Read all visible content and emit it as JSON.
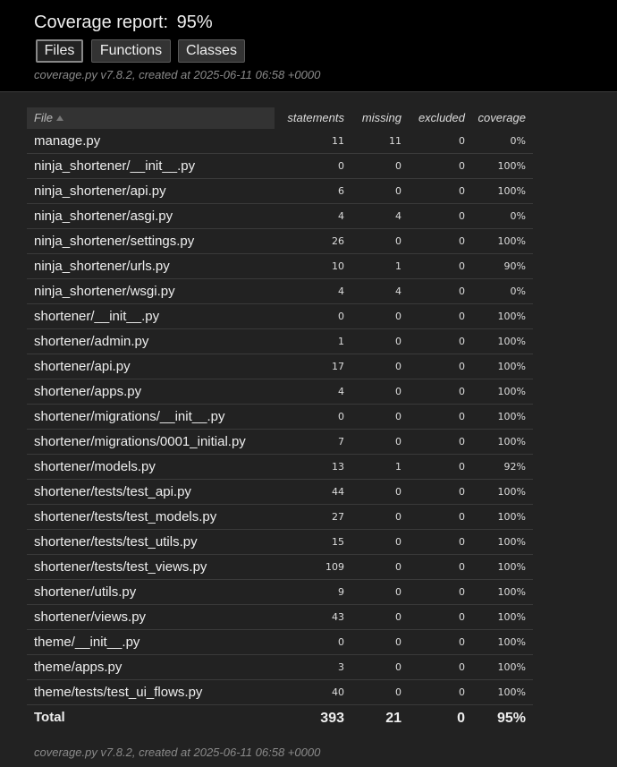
{
  "header": {
    "title": "Coverage report:",
    "percent": "95%",
    "tabs": [
      {
        "label": "Files"
      },
      {
        "label": "Functions"
      },
      {
        "label": "Classes"
      }
    ],
    "meta": "coverage.py v7.8.2, created at 2025-06-11 06:58 +0000"
  },
  "table": {
    "columns": [
      "File",
      "statements",
      "missing",
      "excluded",
      "coverage"
    ],
    "rows": [
      {
        "file": "manage.py",
        "statements": "11",
        "missing": "11",
        "excluded": "0",
        "coverage": "0%"
      },
      {
        "file": "ninja_shortener/__init__.py",
        "statements": "0",
        "missing": "0",
        "excluded": "0",
        "coverage": "100%"
      },
      {
        "file": "ninja_shortener/api.py",
        "statements": "6",
        "missing": "0",
        "excluded": "0",
        "coverage": "100%"
      },
      {
        "file": "ninja_shortener/asgi.py",
        "statements": "4",
        "missing": "4",
        "excluded": "0",
        "coverage": "0%"
      },
      {
        "file": "ninja_shortener/settings.py",
        "statements": "26",
        "missing": "0",
        "excluded": "0",
        "coverage": "100%"
      },
      {
        "file": "ninja_shortener/urls.py",
        "statements": "10",
        "missing": "1",
        "excluded": "0",
        "coverage": "90%"
      },
      {
        "file": "ninja_shortener/wsgi.py",
        "statements": "4",
        "missing": "4",
        "excluded": "0",
        "coverage": "0%"
      },
      {
        "file": "shortener/__init__.py",
        "statements": "0",
        "missing": "0",
        "excluded": "0",
        "coverage": "100%"
      },
      {
        "file": "shortener/admin.py",
        "statements": "1",
        "missing": "0",
        "excluded": "0",
        "coverage": "100%"
      },
      {
        "file": "shortener/api.py",
        "statements": "17",
        "missing": "0",
        "excluded": "0",
        "coverage": "100%"
      },
      {
        "file": "shortener/apps.py",
        "statements": "4",
        "missing": "0",
        "excluded": "0",
        "coverage": "100%"
      },
      {
        "file": "shortener/migrations/__init__.py",
        "statements": "0",
        "missing": "0",
        "excluded": "0",
        "coverage": "100%"
      },
      {
        "file": "shortener/migrations/0001_initial.py",
        "statements": "7",
        "missing": "0",
        "excluded": "0",
        "coverage": "100%"
      },
      {
        "file": "shortener/models.py",
        "statements": "13",
        "missing": "1",
        "excluded": "0",
        "coverage": "92%"
      },
      {
        "file": "shortener/tests/test_api.py",
        "statements": "44",
        "missing": "0",
        "excluded": "0",
        "coverage": "100%"
      },
      {
        "file": "shortener/tests/test_models.py",
        "statements": "27",
        "missing": "0",
        "excluded": "0",
        "coverage": "100%"
      },
      {
        "file": "shortener/tests/test_utils.py",
        "statements": "15",
        "missing": "0",
        "excluded": "0",
        "coverage": "100%"
      },
      {
        "file": "shortener/tests/test_views.py",
        "statements": "109",
        "missing": "0",
        "excluded": "0",
        "coverage": "100%"
      },
      {
        "file": "shortener/utils.py",
        "statements": "9",
        "missing": "0",
        "excluded": "0",
        "coverage": "100%"
      },
      {
        "file": "shortener/views.py",
        "statements": "43",
        "missing": "0",
        "excluded": "0",
        "coverage": "100%"
      },
      {
        "file": "theme/__init__.py",
        "statements": "0",
        "missing": "0",
        "excluded": "0",
        "coverage": "100%"
      },
      {
        "file": "theme/apps.py",
        "statements": "3",
        "missing": "0",
        "excluded": "0",
        "coverage": "100%"
      },
      {
        "file": "theme/tests/test_ui_flows.py",
        "statements": "40",
        "missing": "0",
        "excluded": "0",
        "coverage": "100%"
      }
    ],
    "total": {
      "file": "Total",
      "statements": "393",
      "missing": "21",
      "excluded": "0",
      "coverage": "95%"
    },
    "sort_icon": "sort-ascending-icon"
  },
  "footer": {
    "meta": "coverage.py v7.8.2, created at 2025-06-11 06:58 +0000"
  },
  "colors": {
    "header_bg": "#000000",
    "page_bg": "#222222",
    "text": "#eeeeee",
    "muted": "#8a8a8a"
  }
}
